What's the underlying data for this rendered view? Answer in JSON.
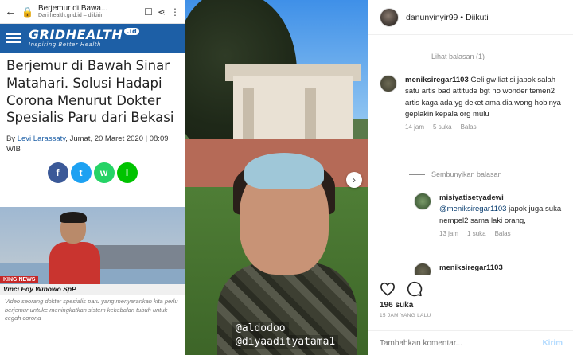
{
  "browser": {
    "tab_title": "Berjemur di Bawa...",
    "url": "Dari health.grid.id – diikirin"
  },
  "site": {
    "logo": "GRIDHEALTH",
    "logo_suffix": ".id",
    "tagline": "Inspiring Better Health"
  },
  "article": {
    "title": "Berjemur di Bawah Sinar Matahari. Solusi Hadapi Corona Menurut Dokter Spesialis Paru dari Bekasi",
    "by": "By",
    "author": "Levi Larassaty",
    "date": ", Jumat, 20 Maret 2020 | 08:09 WIB",
    "share": [
      "f",
      "t",
      "w",
      "l"
    ],
    "news_tag": "KING NEWS",
    "name_bar": "Vinci Edy Wibowo SpP",
    "caption": "Video seorang dokter spesialis paru yang menyarankan kita perlu berjemur untuke meningkatkan sistem kekebalan tubuh untuk cegah corona"
  },
  "story": {
    "tags": [
      "@aldodoo",
      "@diyaadityatama1"
    ]
  },
  "instagram": {
    "username": "danunyinyir99",
    "follow_label": "Diikuti",
    "view_replies": "Lihat balasan (1)",
    "comments": [
      {
        "user": "meniksiregar1103",
        "text": "Geli gw liat si japok salah satu artis bad attitude bgt no wonder temen2 artis kaga ada yg deket ama dia wong hobinya geplakin kepala org mulu",
        "time": "14 jam",
        "likes": "5 suka",
        "reply": "Balas"
      }
    ],
    "hide_replies": "Sembunyikan balasan",
    "reply": {
      "user": "misiyatisetyadewi",
      "mention": "@meniksiregar1103",
      "text": "japok juga suka nempel2 sama laki orang,",
      "time": "13 jam",
      "likes": "1 suka",
      "reply": "Balas"
    },
    "next_user": "meniksiregar1103",
    "likes_count": "196 suka",
    "time_ago": "15 JAM YANG LALU",
    "add_comment_placeholder": "Tambahkan komentar...",
    "post_label": "Kirim"
  }
}
